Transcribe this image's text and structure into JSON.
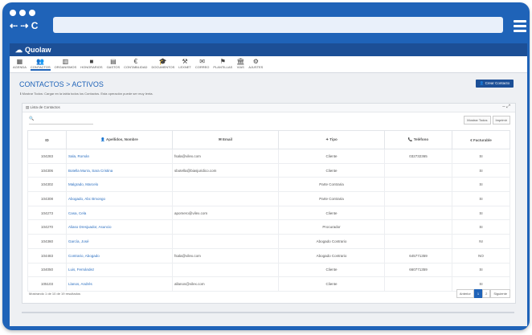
{
  "browser": {
    "nav_icons": "⇠ ⇢ C"
  },
  "app": {
    "name": "Quolaw"
  },
  "menu": [
    {
      "label": "AGENDA",
      "icon": "calendar-icon",
      "glyph": "▦"
    },
    {
      "label": "CONTACTOS",
      "icon": "contacts-icon",
      "glyph": "👥"
    },
    {
      "label": "ORGANISMOS",
      "icon": "building-icon",
      "glyph": "▥"
    },
    {
      "label": "HONORARIOS",
      "icon": "briefcase-icon",
      "glyph": "■"
    },
    {
      "label": "GASTOS",
      "icon": "calendar-icon",
      "glyph": "▤"
    },
    {
      "label": "CONTABILIDAD",
      "icon": "euro-icon",
      "glyph": "€"
    },
    {
      "label": "DOCUMENTOS",
      "icon": "graduation-icon",
      "glyph": "🎓"
    },
    {
      "label": "LEXNET",
      "icon": "gavel-icon",
      "glyph": "⚒"
    },
    {
      "label": "CORREO",
      "icon": "mail-icon",
      "glyph": "✉"
    },
    {
      "label": "PLANTILLAS",
      "icon": "tag-icon",
      "glyph": "⚑"
    },
    {
      "label": "VIAS",
      "icon": "institution-icon",
      "glyph": "🏛"
    },
    {
      "label": "AJUSTES",
      "icon": "gears-icon",
      "glyph": "⚙"
    }
  ],
  "page": {
    "title": "CONTACTOS > ACTIVOS",
    "info": "ℹ Mostrar Todos: Cargar en la tabla todos los Contactos. Esta operación puede ser muy lenta.",
    "create_button": "👤 Crear Contacto"
  },
  "panel": {
    "title": "▤ Lista de Contactos",
    "controls": "– ⤢",
    "search_icon": "🔍",
    "show_all": "Mostrar Todos",
    "print": "Imprimir"
  },
  "table": {
    "headers": [
      "ID",
      "👤 Apellidos, Nombre",
      "✉ Email",
      "✦ Tipo",
      "📞 Teléfono",
      "€ Facturable"
    ],
    "rows": [
      [
        "104283",
        "Sala, Román",
        "fsala@vilex.com",
        "Cliente",
        "032732365",
        "SI"
      ],
      [
        "104306",
        "Botella Murra, Sara Cristina",
        "sbotella@biasjuridico.com",
        "Cliente",
        "",
        "SI"
      ],
      [
        "104302",
        "Malgrado, Marcelo",
        "",
        "Parte Contraria",
        "",
        "SI"
      ],
      [
        "104308",
        "Abogado, Abc Bmongo",
        "",
        "Parte Contraria",
        "",
        "SI"
      ],
      [
        "104273",
        "Casa, Cela",
        "apomero@vilex.com",
        "Cliente",
        "",
        "SI"
      ],
      [
        "104270",
        "Aliaso Dresjuador, Asuncio",
        "",
        "Procurador",
        "",
        "SI"
      ],
      [
        "104360",
        "García, José",
        "",
        "Abogado Contrario",
        "",
        "NI"
      ],
      [
        "104483",
        "Contrario, Abogado",
        "fsala@vilex.com",
        "Abogado Contrario",
        "645771359",
        "NO"
      ],
      [
        "104050",
        "Luis, Fernández",
        "",
        "Cliente",
        "660771359",
        "SI"
      ],
      [
        "105103",
        "Llanos, Andrés",
        "allanos@vilex.com",
        "Cliente",
        "",
        "SI"
      ]
    ]
  },
  "footer": {
    "summary": "Mostrando 1 de 10 de 19 resultados",
    "prev": "Anterior",
    "page1": "1",
    "page2": "2",
    "next": "Siguiente"
  }
}
